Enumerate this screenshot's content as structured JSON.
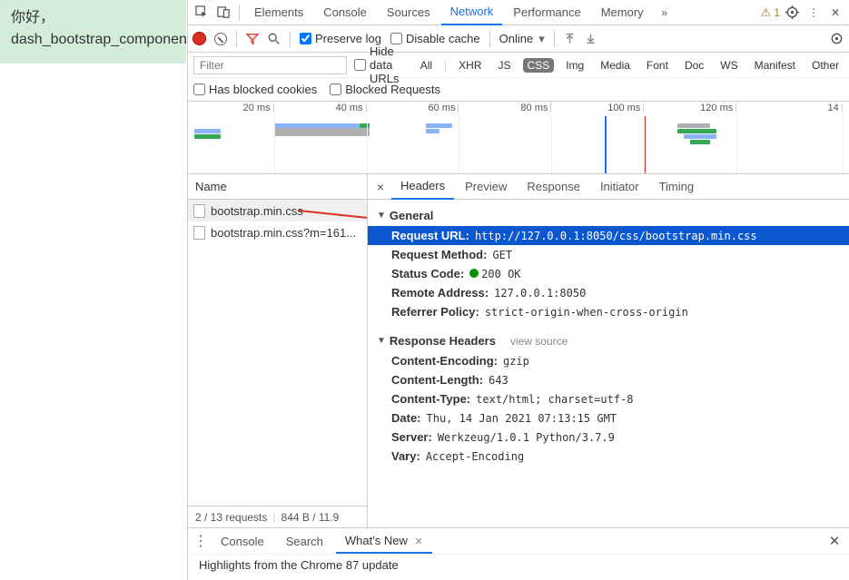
{
  "page": {
    "greeting": "你好，",
    "text": "dash_bootstrap_componen"
  },
  "topTabs": {
    "elements": "Elements",
    "console": "Console",
    "sources": "Sources",
    "network": "Network",
    "performance": "Performance",
    "memory": "Memory"
  },
  "warnCount": "1",
  "netToolbar": {
    "preserveLog": "Preserve log",
    "disableCache": "Disable cache",
    "throttling": "Online"
  },
  "filter": {
    "placeholder": "Filter",
    "hideDataUrls": "Hide data URLs",
    "types": {
      "all": "All",
      "xhr": "XHR",
      "js": "JS",
      "css": "CSS",
      "img": "Img",
      "media": "Media",
      "font": "Font",
      "doc": "Doc",
      "ws": "WS",
      "manifest": "Manifest",
      "other": "Other"
    },
    "hasBlockedCookies": "Has blocked cookies",
    "blockedRequests": "Blocked Requests"
  },
  "timeline": {
    "ticks": [
      {
        "label": "20 ms",
        "pct": 13
      },
      {
        "label": "40 ms",
        "pct": 27
      },
      {
        "label": "60 ms",
        "pct": 41
      },
      {
        "label": "80 ms",
        "pct": 55
      },
      {
        "label": "100 ms",
        "pct": 69
      },
      {
        "label": "120 ms",
        "pct": 83
      },
      {
        "label": "14",
        "pct": 99
      }
    ]
  },
  "reqList": {
    "header": "Name",
    "rows": [
      {
        "name": "bootstrap.min.css"
      },
      {
        "name": "bootstrap.min.css?m=161..."
      }
    ],
    "footer": {
      "requests": "2 / 13 requests",
      "size": "844 B / 11.9 "
    }
  },
  "detailTabs": {
    "headers": "Headers",
    "preview": "Preview",
    "response": "Response",
    "initiator": "Initiator",
    "timing": "Timing"
  },
  "detail": {
    "generalTitle": "General",
    "general": {
      "url_k": "Request URL:",
      "url_v": "http://127.0.0.1:8050/css/bootstrap.min.css",
      "method_k": "Request Method:",
      "method_v": "GET",
      "status_k": "Status Code:",
      "status_v": "200 OK",
      "remote_k": "Remote Address:",
      "remote_v": "127.0.0.1:8050",
      "referrer_k": "Referrer Policy:",
      "referrer_v": "strict-origin-when-cross-origin"
    },
    "respTitle": "Response Headers",
    "viewSource": "view source",
    "resp": {
      "ce_k": "Content-Encoding:",
      "ce_v": "gzip",
      "cl_k": "Content-Length:",
      "cl_v": "643",
      "ct_k": "Content-Type:",
      "ct_v": "text/html; charset=utf-8",
      "date_k": "Date:",
      "date_v": "Thu, 14 Jan 2021 07:13:15 GMT",
      "server_k": "Server:",
      "server_v": "Werkzeug/1.0.1 Python/3.7.9",
      "vary_k": "Vary:",
      "vary_v": "Accept-Encoding"
    }
  },
  "drawer": {
    "console": "Console",
    "search": "Search",
    "whatsnew": "What's New",
    "body": "Highlights from the Chrome 87 update"
  }
}
